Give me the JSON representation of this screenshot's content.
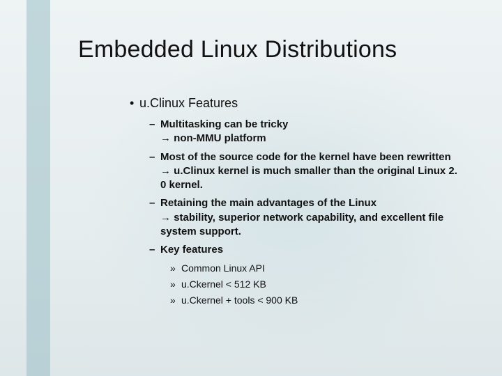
{
  "title": "Embedded Linux Distributions",
  "section": "u.Clinux Features",
  "bullets": {
    "b1_line1": "Multitasking can be tricky",
    "b1_line2": "→ non-MMU platform",
    "b2_line1": "Most of the source code for the kernel have been rewritten",
    "b2_line2": "→ u.Clinux kernel is much smaller than the original Linux 2. 0 kernel.",
    "b3_line1": "Retaining the main advantages of the Linux",
    "b3_line2": "→ stability, superior network capability, and excellent file system support.",
    "b4": "Key features"
  },
  "subbullets": {
    "s1": "Common Linux API",
    "s2": "u.Ckernel < 512 KB",
    "s3": "u.Ckernel + tools < 900 KB"
  },
  "glyphs": {
    "dot": "•",
    "dash": "–",
    "raquo": "»"
  }
}
